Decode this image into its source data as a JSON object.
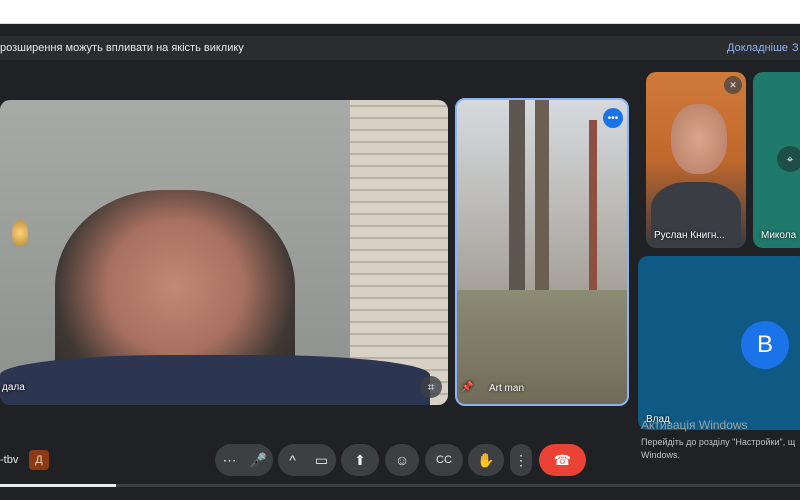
{
  "banner": {
    "text": "розширення можуть впливати на якість виклику",
    "link": "Докладніше",
    "close": "З"
  },
  "participants": {
    "main": {
      "name": "дала"
    },
    "art": {
      "name": "Art man"
    },
    "ruslan": {
      "name": "Руслан Книгн..."
    },
    "mykola": {
      "name": "Микола"
    },
    "vlad": {
      "name": "Влад",
      "avatar_letter": "B"
    }
  },
  "activation": {
    "title": "Активація Windows",
    "line1": "Перейдіть до розділу \"Настройки\", щ",
    "line2": "Windows."
  },
  "meeting": {
    "code": "-tbv",
    "badge": "Д"
  },
  "controls": {
    "more": "⋯",
    "mic": "🎤",
    "chevron": "^",
    "camera": "▭",
    "present": "⬆",
    "emoji": "☺",
    "captions": "CC",
    "hand": "✋",
    "options": "⋮",
    "end": "☎"
  },
  "progress": {
    "fraction": 0.145
  },
  "colors": {
    "accent": "#8ab4f8",
    "end_call": "#ea4335",
    "avatar": "#1a73e8"
  }
}
